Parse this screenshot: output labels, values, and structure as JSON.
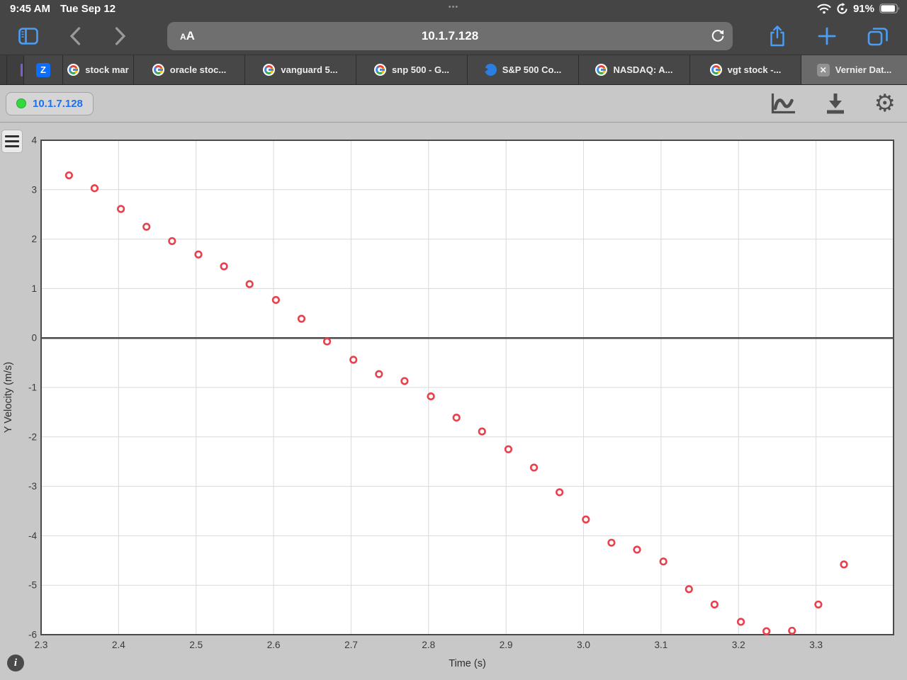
{
  "status_bar": {
    "time": "9:45 AM",
    "date": "Tue Sep 12",
    "handle": "•••",
    "battery_percent": "91%"
  },
  "browser_toolbar": {
    "text_size_label_small": "A",
    "text_size_label_large": "A",
    "address": "10.1.7.128"
  },
  "tab_bar": {
    "tabs": [
      {
        "label": "",
        "icon": "zillow"
      },
      {
        "label": "stock mar",
        "icon": "google"
      },
      {
        "label": "oracle stoc...",
        "icon": "google"
      },
      {
        "label": "vanguard 5...",
        "icon": "google"
      },
      {
        "label": "snp 500 - G...",
        "icon": "google"
      },
      {
        "label": "S&P 500 Co...",
        "icon": "sp500"
      },
      {
        "label": "NASDAQ: A...",
        "icon": "google"
      },
      {
        "label": "vgt stock -...",
        "icon": "google"
      },
      {
        "label": "Vernier Dat...",
        "icon": "close",
        "active": true
      }
    ]
  },
  "app_toolbar": {
    "connection_label": "10.1.7.128",
    "status_dot_color": "#35d93f",
    "accent_blue": "#1f6ff2"
  },
  "chart_data": {
    "type": "scatter",
    "title": "",
    "xlabel": "Time (s)",
    "ylabel": "Y Velocity (m/s)",
    "xlim": [
      2.3,
      3.4
    ],
    "ylim": [
      -6,
      4
    ],
    "x_ticks": [
      "2.3",
      "2.4",
      "2.5",
      "2.6",
      "2.7",
      "2.8",
      "2.9",
      "3.0",
      "3.1",
      "3.2",
      "3.3"
    ],
    "y_ticks": [
      "4",
      "3",
      "2",
      "1",
      "0",
      "-1",
      "-2",
      "-3",
      "-4",
      "-5",
      "-6"
    ],
    "grid": true,
    "zero_line": true,
    "legend": "none",
    "point_color": "#e8414d",
    "series": [
      {
        "name": "Y Velocity",
        "points": [
          [
            2.336,
            3.29
          ],
          [
            2.369,
            3.03
          ],
          [
            2.403,
            2.61
          ],
          [
            2.436,
            2.25
          ],
          [
            2.469,
            1.96
          ],
          [
            2.503,
            1.69
          ],
          [
            2.536,
            1.45
          ],
          [
            2.569,
            1.09
          ],
          [
            2.603,
            0.77
          ],
          [
            2.636,
            0.39
          ],
          [
            2.669,
            -0.07
          ],
          [
            2.703,
            -0.44
          ],
          [
            2.736,
            -0.73
          ],
          [
            2.769,
            -0.87
          ],
          [
            2.803,
            -1.18
          ],
          [
            2.836,
            -1.61
          ],
          [
            2.869,
            -1.89
          ],
          [
            2.903,
            -2.25
          ],
          [
            2.936,
            -2.62
          ],
          [
            2.969,
            -3.12
          ],
          [
            3.003,
            -3.67
          ],
          [
            3.036,
            -4.14
          ],
          [
            3.069,
            -4.28
          ],
          [
            3.103,
            -4.52
          ],
          [
            3.136,
            -5.08
          ],
          [
            3.169,
            -5.39
          ],
          [
            3.203,
            -5.74
          ],
          [
            3.236,
            -5.93
          ],
          [
            3.269,
            -5.92
          ],
          [
            3.303,
            -5.39
          ],
          [
            3.336,
            -4.58
          ]
        ]
      }
    ]
  }
}
